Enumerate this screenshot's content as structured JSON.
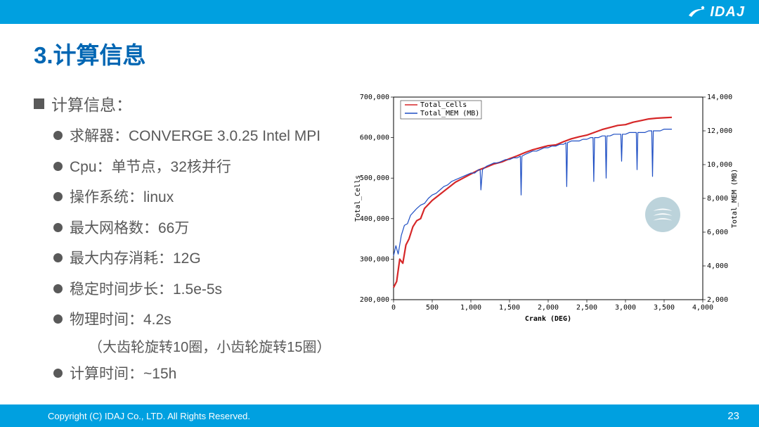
{
  "header": {
    "brand": "IDAJ"
  },
  "title": "3.计算信息",
  "section_label": "计算信息：",
  "bullets": [
    "求解器：CONVERGE 3.0.25 Intel MPI",
    "Cpu：单节点，32核并行",
    "操作系统：linux",
    "最大网格数：66万",
    "最大内存消耗：12G",
    "稳定时间步长：1.5e-5s",
    "物理时间：4.2s",
    "计算时间：~15h"
  ],
  "paren_note": "（大齿轮旋转10圈，小齿轮旋转15圈）",
  "footer": {
    "copyright": "Copyright (C)  IDAJ Co., LTD. All Rights Reserved.",
    "page": "23"
  },
  "chart_data": {
    "type": "line",
    "xlabel": "Crank (DEG)",
    "y1_name": "Total_Cells",
    "y2_name": "Total_MEM (MB)",
    "x_ticks": [
      0,
      500,
      1000,
      1500,
      2000,
      2500,
      3000,
      3500,
      4000
    ],
    "y1_ticks": [
      200000,
      300000,
      400000,
      500000,
      600000,
      700000
    ],
    "y2_ticks": [
      2000,
      4000,
      6000,
      8000,
      10000,
      12000,
      14000
    ],
    "y1_range": [
      200000,
      700000
    ],
    "y2_range": [
      2000,
      14000
    ],
    "x_range": [
      0,
      4000
    ],
    "legend": [
      "Total_Cells",
      "Total_MEM (MB)"
    ],
    "legend_colors": [
      "#d62728",
      "#1f4fc4"
    ],
    "series": [
      {
        "name": "Total_Cells",
        "color": "#d62728",
        "axis": "y1",
        "x": [
          0,
          40,
          80,
          120,
          160,
          200,
          250,
          300,
          350,
          400,
          500,
          600,
          700,
          800,
          900,
          1000,
          1100,
          1200,
          1300,
          1400,
          1500,
          1600,
          1700,
          1800,
          1900,
          2000,
          2100,
          2200,
          2300,
          2400,
          2500,
          2600,
          2700,
          2800,
          2900,
          3000,
          3100,
          3200,
          3300,
          3400,
          3500,
          3600
        ],
        "values": [
          230000,
          245000,
          300000,
          290000,
          335000,
          350000,
          380000,
          395000,
          400000,
          425000,
          445000,
          460000,
          475000,
          490000,
          500000,
          510000,
          520000,
          527000,
          535000,
          540000,
          548000,
          555000,
          563000,
          570000,
          575000,
          580000,
          582000,
          590000,
          597000,
          602000,
          606000,
          613000,
          620000,
          625000,
          630000,
          632000,
          638000,
          642000,
          646000,
          648000,
          649000,
          650000
        ]
      },
      {
        "name": "Total_MEM (MB)",
        "color": "#1f4fc4",
        "axis": "y2",
        "x": [
          0,
          30,
          60,
          100,
          140,
          180,
          220,
          260,
          300,
          350,
          400,
          450,
          500,
          550,
          600,
          650,
          700,
          750,
          800,
          850,
          900,
          950,
          1000,
          1050,
          1100,
          1120,
          1130,
          1150,
          1200,
          1250,
          1300,
          1350,
          1400,
          1450,
          1500,
          1550,
          1600,
          1640,
          1650,
          1660,
          1700,
          1750,
          1800,
          1850,
          1900,
          1950,
          2000,
          2050,
          2100,
          2150,
          2200,
          2230,
          2240,
          2250,
          2300,
          2350,
          2400,
          2450,
          2500,
          2550,
          2580,
          2590,
          2600,
          2650,
          2700,
          2740,
          2750,
          2760,
          2800,
          2850,
          2900,
          2940,
          2950,
          2960,
          3000,
          3050,
          3100,
          3140,
          3150,
          3160,
          3200,
          3250,
          3300,
          3340,
          3350,
          3360,
          3400,
          3450,
          3500,
          3600
        ],
        "values": [
          4600,
          5200,
          4700,
          5800,
          6400,
          6500,
          7000,
          7200,
          7400,
          7600,
          7700,
          8000,
          8200,
          8300,
          8500,
          8700,
          8800,
          9000,
          9100,
          9200,
          9300,
          9400,
          9500,
          9500,
          9700,
          9700,
          8500,
          9700,
          9900,
          10000,
          10100,
          10100,
          10200,
          10300,
          10300,
          10400,
          10400,
          10500,
          8200,
          10500,
          10600,
          10700,
          10800,
          10800,
          10900,
          11000,
          11000,
          11100,
          11100,
          11200,
          11200,
          11300,
          8700,
          11300,
          11400,
          11400,
          11400,
          11500,
          11500,
          11600,
          11600,
          9000,
          11600,
          11600,
          11700,
          11700,
          9200,
          11700,
          11700,
          11800,
          11800,
          11800,
          10200,
          11800,
          11800,
          11900,
          11900,
          11900,
          9700,
          11900,
          11900,
          11900,
          12000,
          12000,
          9300,
          12000,
          12000,
          12000,
          12100,
          12100
        ]
      }
    ]
  }
}
